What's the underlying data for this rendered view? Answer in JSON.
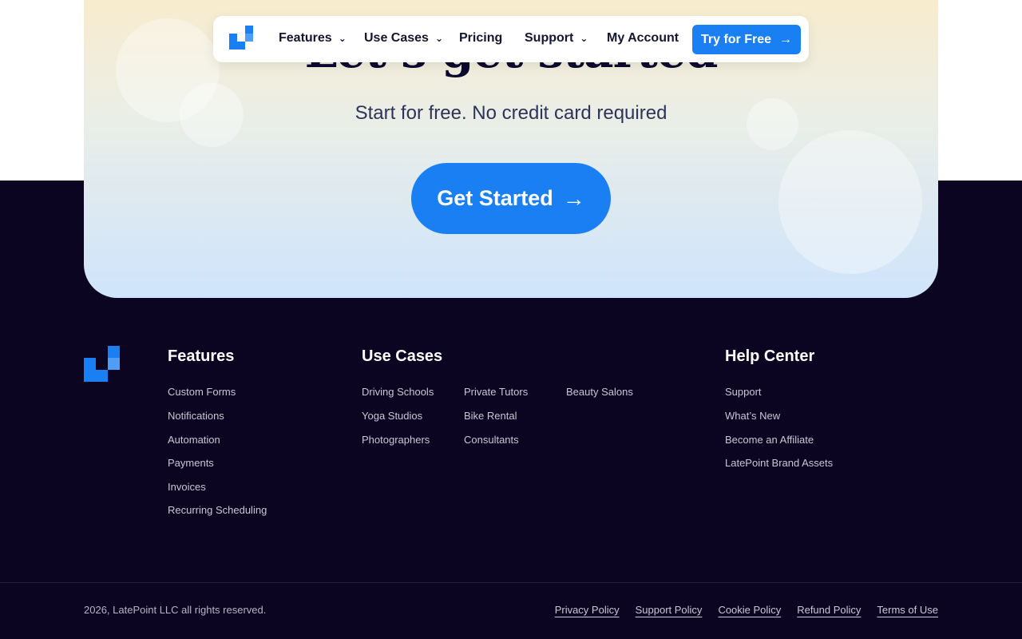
{
  "hero": {
    "title": "Let’s get started",
    "subtitle": "Start for free. No credit card required",
    "cta_label": "Get Started",
    "accent_color": "#1a7ff3"
  },
  "nav": {
    "logo_icon": "latepoint-logo-icon",
    "items": [
      {
        "label": "Features",
        "has_dropdown": true
      },
      {
        "label": "Use Cases",
        "has_dropdown": true
      },
      {
        "label": "Pricing",
        "has_dropdown": false
      },
      {
        "label": "Support",
        "has_dropdown": true
      },
      {
        "label": "My Account",
        "has_dropdown": false
      }
    ],
    "try_label": "Try for Free"
  },
  "footer": {
    "features": {
      "heading": "Features",
      "links": [
        "Custom Forms",
        "Notifications",
        "Automation",
        "Payments",
        "Invoices",
        "Recurring Scheduling"
      ]
    },
    "use_cases": {
      "heading": "Use Cases",
      "links": [
        "Driving Schools",
        "Yoga Studios",
        "Photographers",
        "Private Tutors",
        "Bike Rental",
        "Consultants",
        "Beauty Salons"
      ]
    },
    "help": {
      "heading": "Help Center",
      "links": [
        "Support",
        "What’s New",
        "Become an Affiliate",
        "LatePoint Brand Assets"
      ]
    },
    "copyright": "2026, LatePoint LLC all rights reserved.",
    "policies": [
      "Privacy Policy",
      "Support Policy",
      "Cookie Policy",
      "Refund Policy",
      "Terms of Use"
    ]
  }
}
